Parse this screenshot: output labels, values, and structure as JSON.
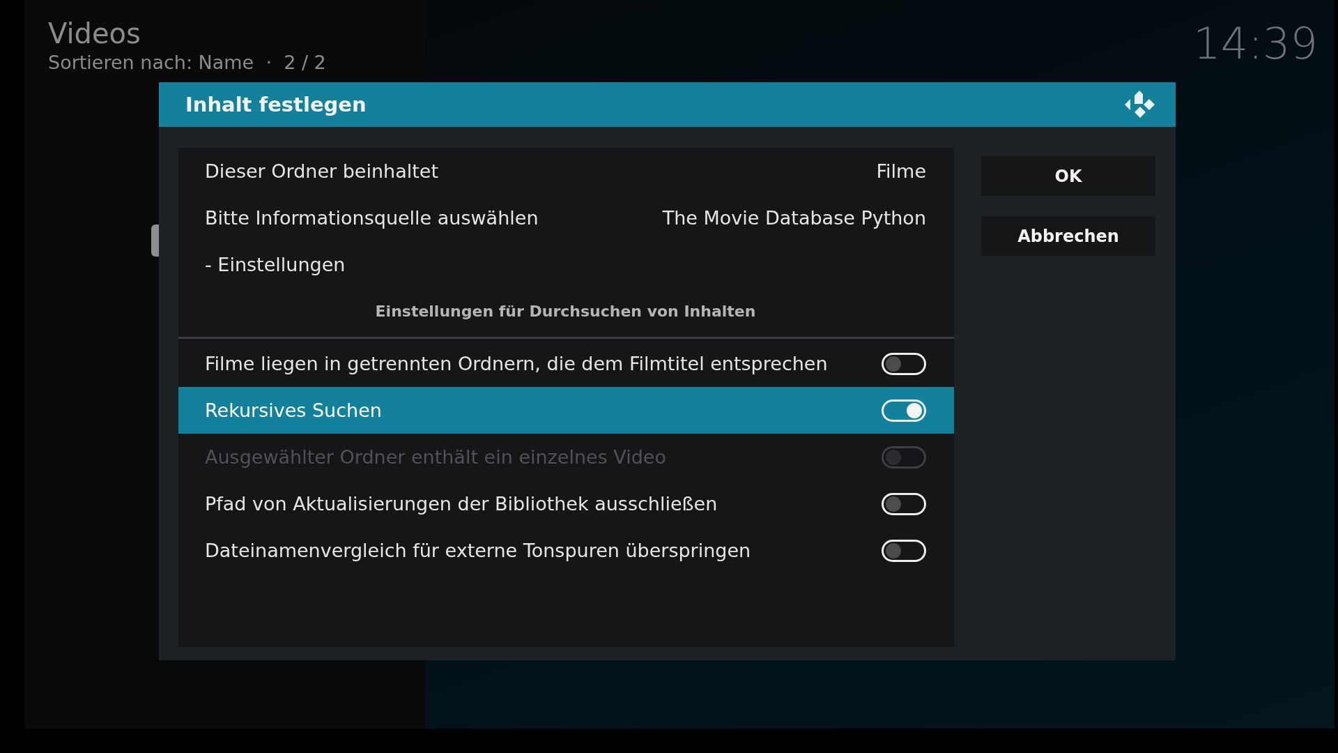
{
  "header": {
    "title": "Videos",
    "subtitle": "Sortieren nach: Name  ·  2 / 2",
    "clock": "14:39"
  },
  "dialog": {
    "title": "Inhalt festlegen",
    "rows": [
      {
        "kind": "value",
        "label": "Dieser Ordner beinhaltet",
        "value": "Filme",
        "selected": false
      },
      {
        "kind": "value",
        "label": "Bitte Informationsquelle auswählen",
        "value": "The Movie Database Python",
        "selected": false
      },
      {
        "kind": "action",
        "label": "- Einstellungen",
        "selected": false
      },
      {
        "kind": "header",
        "label": "Einstellungen für Durchsuchen von Inhalten"
      },
      {
        "kind": "toggle",
        "label": "Filme liegen in getrennten Ordnern, die dem Filmtitel entsprechen",
        "on": false,
        "disabled": false,
        "selected": false
      },
      {
        "kind": "toggle",
        "label": "Rekursives Suchen",
        "on": true,
        "disabled": false,
        "selected": true
      },
      {
        "kind": "toggle",
        "label": "Ausgewählter Ordner enthält ein einzelnes Video",
        "on": false,
        "disabled": true,
        "selected": false
      },
      {
        "kind": "toggle",
        "label": "Pfad von Aktualisierungen der Bibliothek ausschließen",
        "on": false,
        "disabled": false,
        "selected": false
      },
      {
        "kind": "toggle",
        "label": "Dateinamenvergleich für externe Tonspuren überspringen",
        "on": false,
        "disabled": false,
        "selected": false
      }
    ],
    "buttons": [
      "OK",
      "Abbrechen"
    ]
  }
}
